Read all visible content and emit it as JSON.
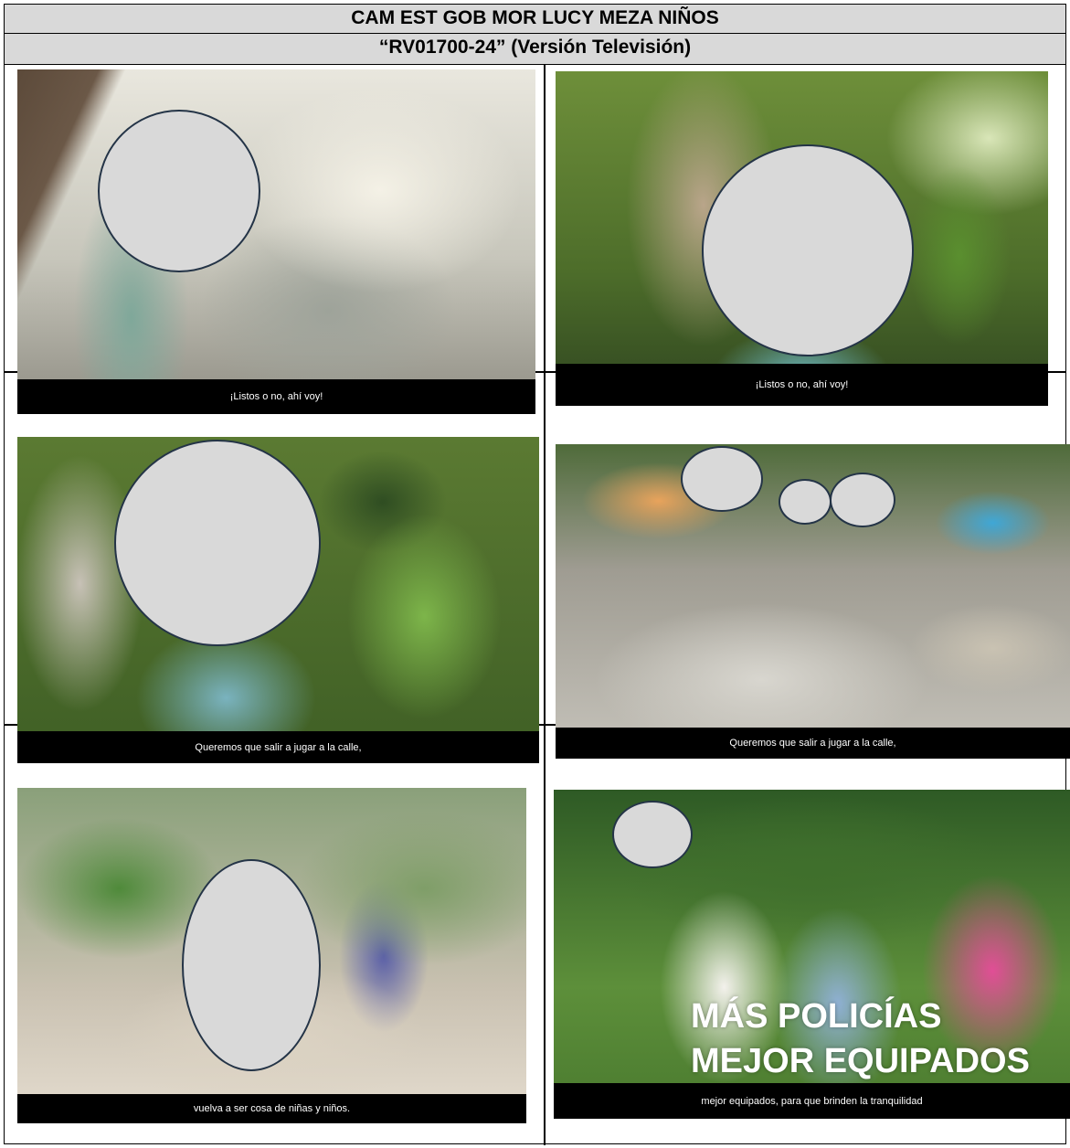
{
  "header": {
    "title": "CAM EST GOB MOR LUCY MEZA NIÑOS",
    "subtitle": "“RV01700-24” (Versión Televisión)"
  },
  "frames": [
    {
      "caption": "¡Listos o no, ahí voy!"
    },
    {
      "caption": "¡Listos o no, ahí voy!"
    },
    {
      "caption": "Queremos que salir a jugar a la calle,"
    },
    {
      "caption": "Queremos que salir a jugar a la calle,"
    },
    {
      "caption": "vuelva a ser cosa de niñas y niños."
    },
    {
      "caption": "mejor equipados, para que brinden la tranquilidad",
      "overlay_lines": [
        "MÁS POLICÍAS",
        "MEJOR EQUIPADOS"
      ]
    }
  ],
  "colors": {
    "header_bg": "#d9d9d9",
    "blur_fill": "#d9d9d9",
    "blur_border": "#243447"
  }
}
